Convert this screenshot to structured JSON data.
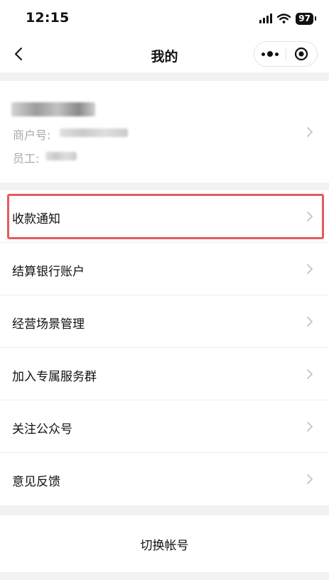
{
  "status_bar": {
    "time": "12:15",
    "battery": "97",
    "icons": [
      "signal-icon",
      "wifi-icon",
      "battery-icon"
    ]
  },
  "nav": {
    "title": "我的",
    "icons": [
      "back-chevron-icon",
      "more-dots-icon",
      "close-target-icon"
    ]
  },
  "profile": {
    "merchant_label": "商户号:",
    "employee_label": "员工:"
  },
  "menu": {
    "items": [
      {
        "label": "收款通知",
        "highlighted": true
      },
      {
        "label": "结算银行账户"
      },
      {
        "label": "经营场景管理"
      },
      {
        "label": "加入专属服务群"
      },
      {
        "label": "关注公众号"
      },
      {
        "label": "意见反馈"
      }
    ]
  },
  "footer": {
    "switch_account_label": "切换帐号"
  },
  "colors": {
    "page_background": "#f2f2f2",
    "card_background": "#ffffff",
    "highlight_border": "#e5595c",
    "secondary_text": "#a8a8a8",
    "chevron": "#c3c3c3"
  }
}
